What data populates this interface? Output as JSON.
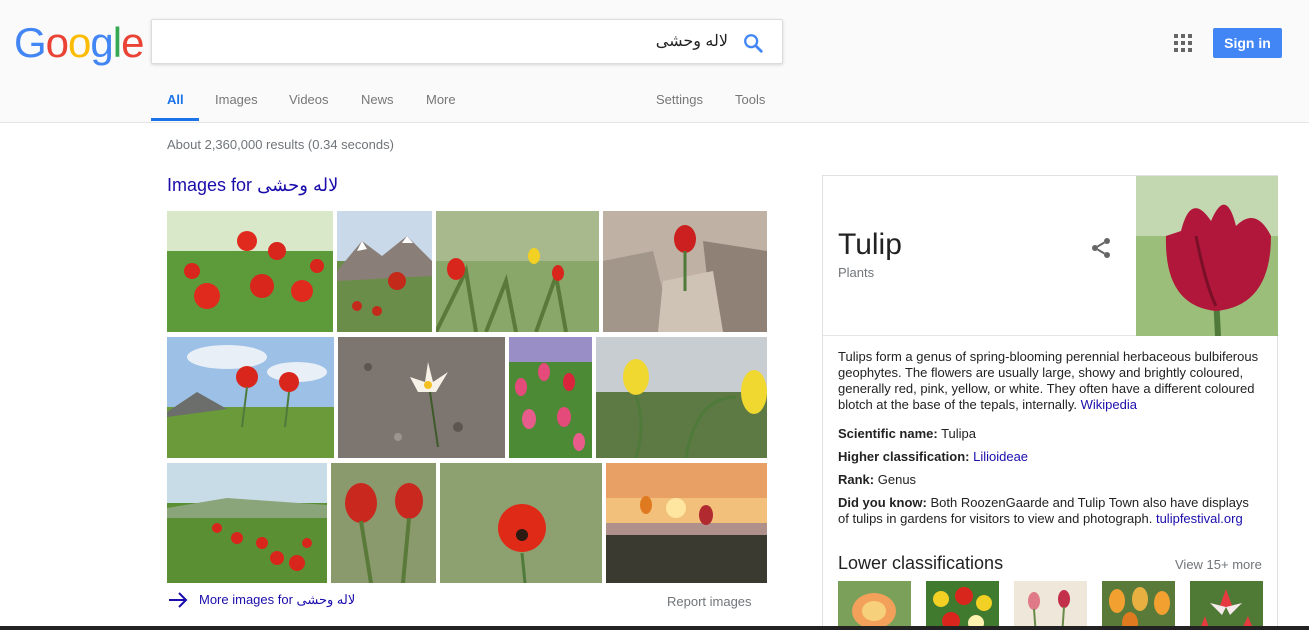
{
  "logo": {
    "letters": [
      "G",
      "o",
      "o",
      "g",
      "l",
      "e"
    ],
    "colors": [
      "#4285f4",
      "#ea4335",
      "#fbbc05",
      "#4285f4",
      "#34a853",
      "#ea4335"
    ]
  },
  "search": {
    "query": "لاله وحشی",
    "icon": "search-icon"
  },
  "header": {
    "apps_icon": "apps-grid-icon",
    "signin_label": "Sign in"
  },
  "tabs": [
    {
      "label": "All",
      "active": true
    },
    {
      "label": "Images",
      "active": false
    },
    {
      "label": "Videos",
      "active": false
    },
    {
      "label": "News",
      "active": false
    },
    {
      "label": "More",
      "active": false
    },
    {
      "label": "Settings",
      "active": false
    },
    {
      "label": "Tools",
      "active": false
    }
  ],
  "result_stats": "About 2,360,000 results (0.34 seconds)",
  "images_section": {
    "heading_prefix": "Images for",
    "heading_query": "لاله وحشی",
    "more_images_label": "More images for لاله وحشی",
    "report_label": "Report images"
  },
  "knowledge_panel": {
    "title": "Tulip",
    "subtitle": "Plants",
    "share_icon": "share-icon",
    "description": "Tulips form a genus of spring-blooming perennial herbaceous bulbiferous geophytes. The flowers are usually large, showy and brightly coloured, generally red, pink, yellow, or white. They often have a different coloured blotch at the base of the tepals, internally.",
    "description_source": "Wikipedia",
    "facts": [
      {
        "label": "Scientific name:",
        "value": "Tulipa",
        "link": false
      },
      {
        "label": "Higher classification:",
        "value": "Lilioideae",
        "link": true
      },
      {
        "label": "Rank:",
        "value": "Genus",
        "link": false
      }
    ],
    "did_you_know": {
      "label": "Did you know:",
      "text": "Both RoozenGaarde and Tulip Town also have displays of tulips in gardens for visitors to view and photograph.",
      "source": "tulipfestival.org"
    },
    "lower_classifications_title": "Lower classifications",
    "view_more_label": "View 15+ more"
  },
  "colors": {
    "link": "#1a0dab",
    "accent": "#1a73e8",
    "signin_bg": "#4285f4"
  }
}
